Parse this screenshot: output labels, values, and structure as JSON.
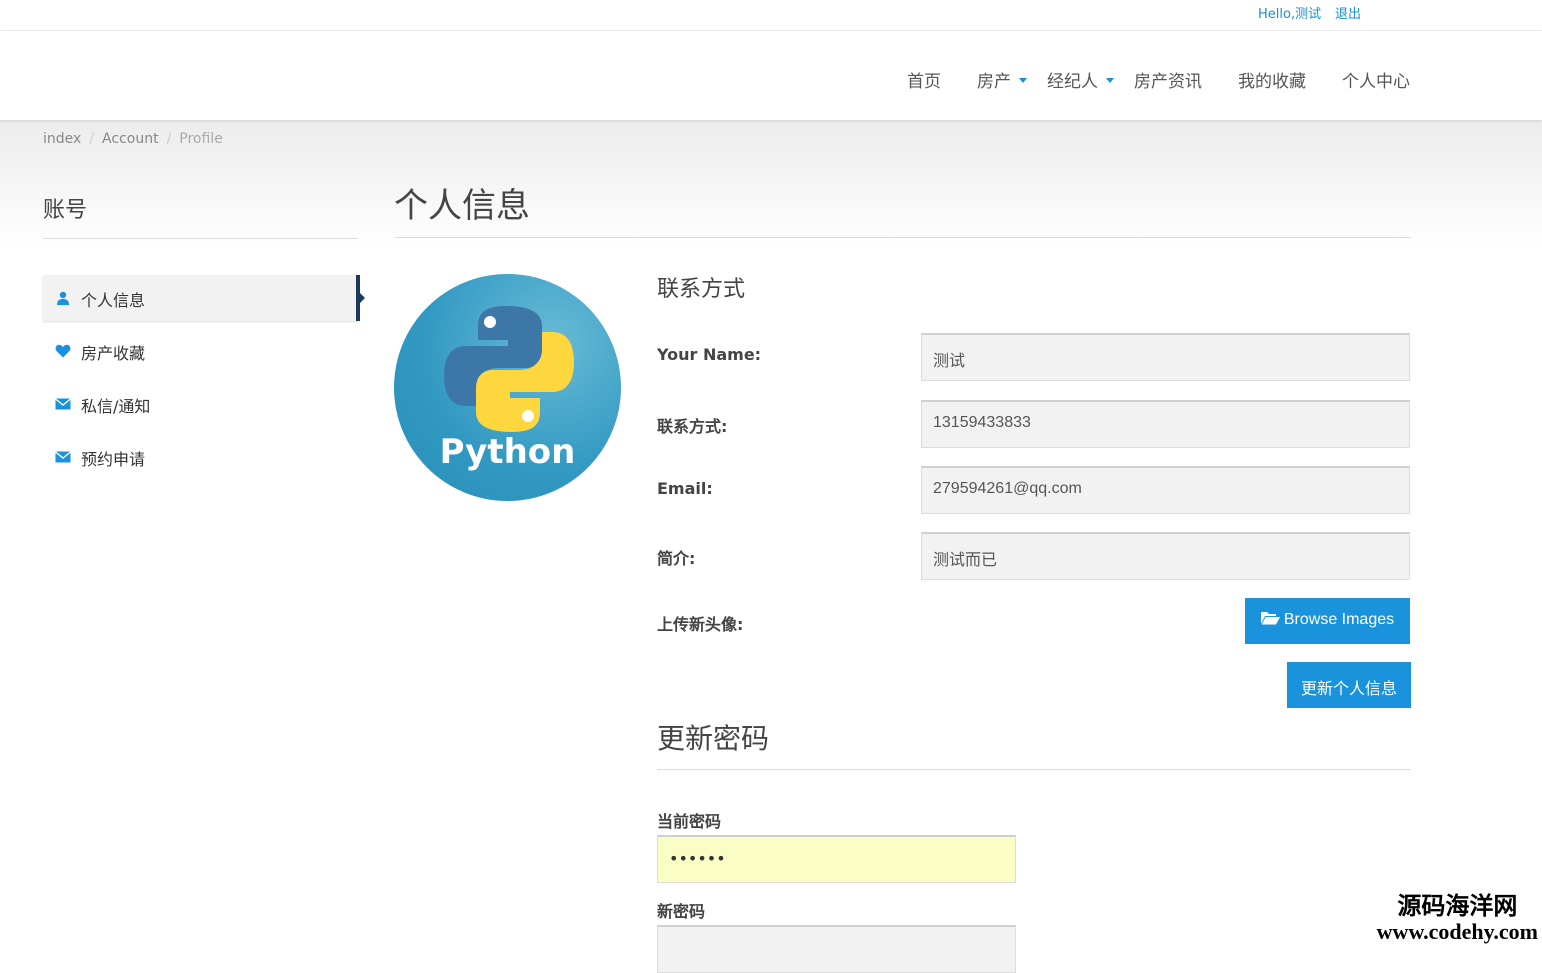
{
  "topbar": {
    "greeting": "Hello,测试",
    "logout": "退出"
  },
  "nav": {
    "home": "首页",
    "property": "房产",
    "agent": "经纪人",
    "news": "房产资讯",
    "favorites": "我的收藏",
    "personal_center": "个人中心"
  },
  "breadcrumb": {
    "index": "index",
    "account": "Account",
    "profile": "Profile"
  },
  "sidebar": {
    "title": "账号",
    "items": [
      {
        "label": "个人信息",
        "icon": "user-icon"
      },
      {
        "label": "房产收藏",
        "icon": "heart-icon"
      },
      {
        "label": "私信/通知",
        "icon": "envelope-icon"
      },
      {
        "label": "预约申请",
        "icon": "envelope-icon"
      }
    ]
  },
  "main": {
    "title": "个人信息",
    "avatar_text": "Python",
    "contact": {
      "heading": "联系方式",
      "name_label": "Your Name:",
      "name_value": "测试",
      "phone_label": "联系方式:",
      "phone_value": "13159433833",
      "email_label": "Email:",
      "email_value": "279594261@qq.com",
      "bio_label": "简介:",
      "bio_value": "测试而已",
      "upload_label": "上传新头像:",
      "browse_button": "Browse Images",
      "update_button": "更新个人信息"
    },
    "password": {
      "heading": "更新密码",
      "current_label": "当前密码",
      "current_value": "••••••",
      "new_label": "新密码",
      "new_value": ""
    }
  },
  "watermark": {
    "line1": "源码海洋网",
    "line2": "www.codehy.com"
  },
  "colors": {
    "accent": "#1a93dc",
    "autofill": "#fafdc4",
    "active_marker": "#1b3a5c"
  }
}
